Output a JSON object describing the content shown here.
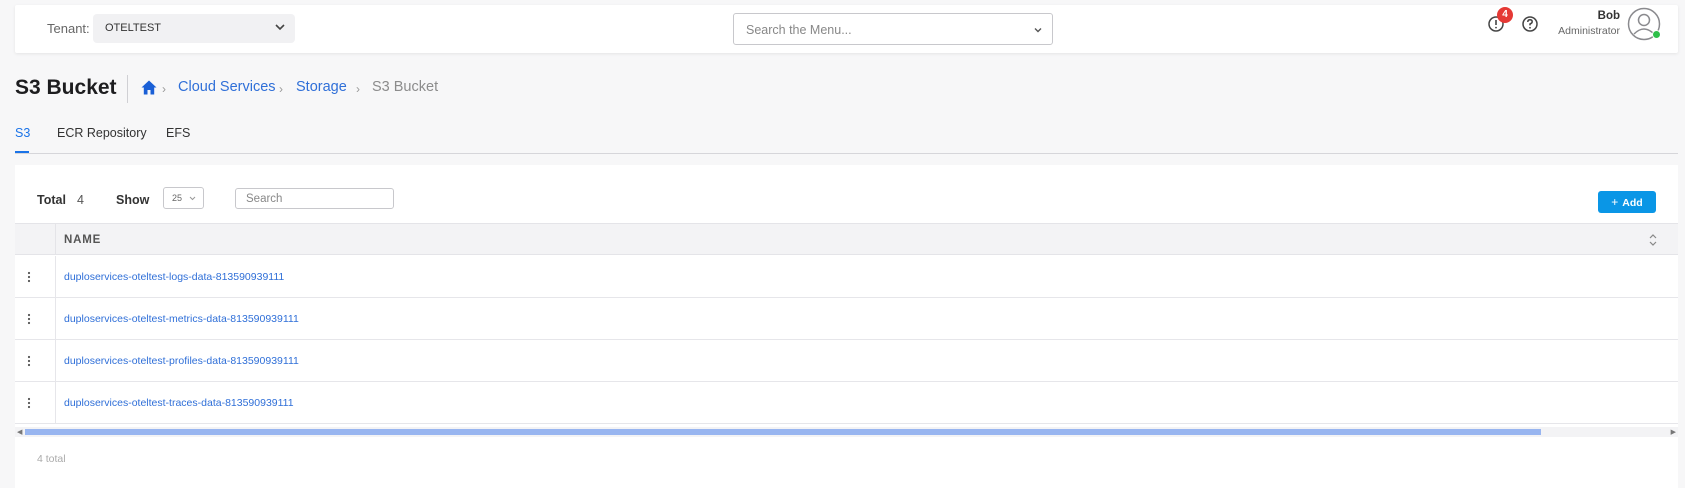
{
  "header": {
    "tenant_label": "Tenant:",
    "tenant_value": "OTELTEST",
    "menu_search_placeholder": "Search the Menu...",
    "alert_count": "4",
    "user_name": "Bob",
    "user_role": "Administrator"
  },
  "page": {
    "title": "S3 Bucket",
    "breadcrumb": [
      "Cloud Services",
      "Storage",
      "S3 Bucket"
    ]
  },
  "tabs": [
    {
      "label": "S3",
      "active": true
    },
    {
      "label": "ECR Repository",
      "active": false
    },
    {
      "label": "EFS",
      "active": false
    }
  ],
  "toolbar": {
    "total_label": "Total",
    "total_count": "4",
    "show_label": "Show",
    "page_size": "25",
    "search_placeholder": "Search",
    "add_label": "Add"
  },
  "table": {
    "columns": [
      "NAME"
    ],
    "rows": [
      {
        "name": "duploservices-oteltest-logs-data-813590939111"
      },
      {
        "name": "duploservices-oteltest-metrics-data-813590939111"
      },
      {
        "name": "duploservices-oteltest-profiles-data-813590939111"
      },
      {
        "name": "duploservices-oteltest-traces-data-813590939111"
      }
    ],
    "footer_total": "4 total"
  },
  "colors": {
    "accent": "#1a73e8",
    "link": "#2f6fd8",
    "add_button": "#0a96e6",
    "badge": "#e53935",
    "online": "#2fbf4a"
  },
  "icons": [
    "chevron-down-icon",
    "alert-icon",
    "help-icon",
    "avatar-icon",
    "home-icon",
    "kebab-icon",
    "sort-icon"
  ]
}
